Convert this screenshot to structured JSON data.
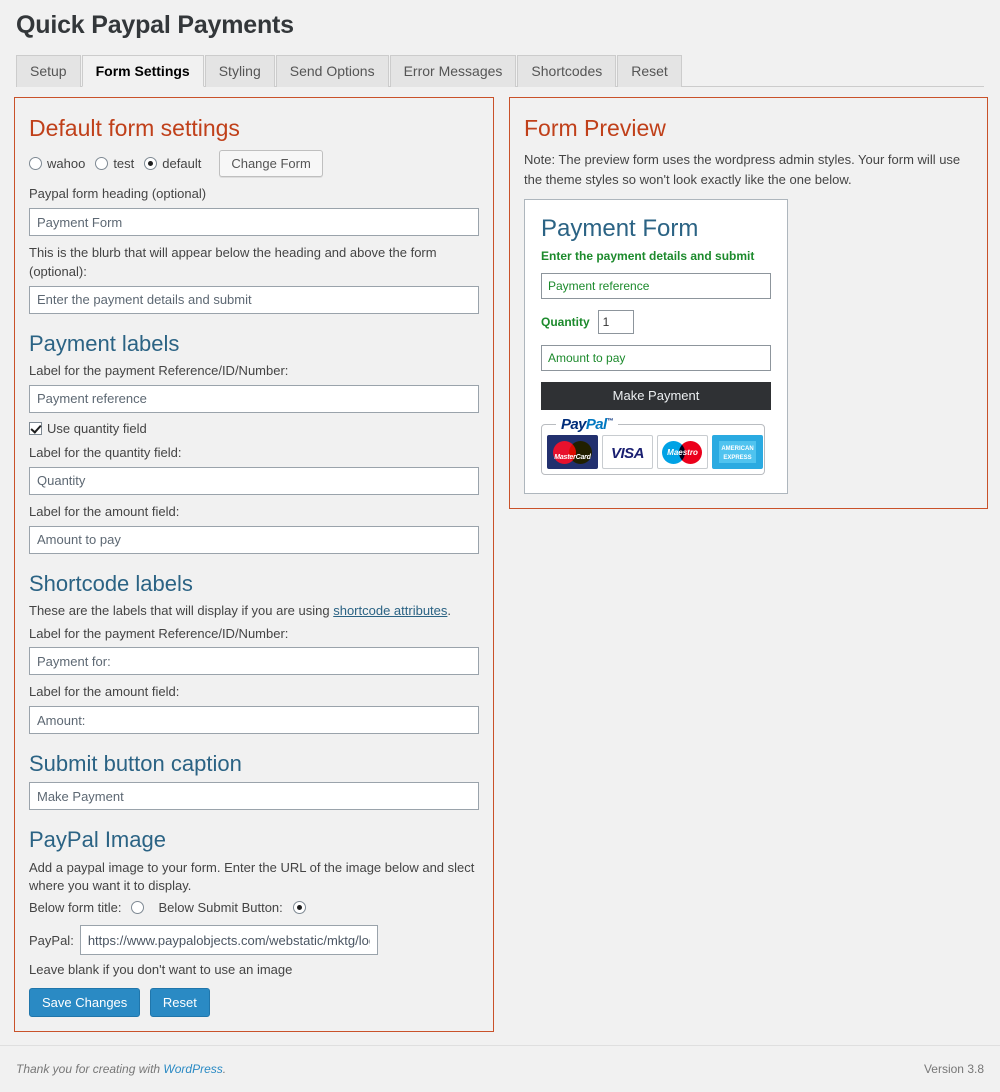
{
  "page_title": "Quick Paypal Payments",
  "tabs": [
    {
      "label": "Setup",
      "active": false
    },
    {
      "label": "Form Settings",
      "active": true
    },
    {
      "label": "Styling",
      "active": false
    },
    {
      "label": "Send Options",
      "active": false
    },
    {
      "label": "Error Messages",
      "active": false
    },
    {
      "label": "Shortcodes",
      "active": false
    },
    {
      "label": "Reset",
      "active": false
    }
  ],
  "left_panel": {
    "heading": "Default form settings",
    "form_radios": [
      {
        "label": "wahoo",
        "checked": false
      },
      {
        "label": "test",
        "checked": false
      },
      {
        "label": "default",
        "checked": true
      }
    ],
    "change_form_button": "Change Form",
    "heading_label": "Paypal form heading (optional)",
    "heading_value": "Payment Form",
    "blurb_label": "This is the blurb that will appear below the heading and above the form (optional):",
    "blurb_value": "Enter the payment details and submit",
    "payment_labels": {
      "heading": "Payment labels",
      "reference_label": "Label for the payment Reference/ID/Number:",
      "reference_value": "Payment reference",
      "use_quantity_label": "Use quantity field",
      "use_quantity_checked": true,
      "quantity_label": "Label for the quantity field:",
      "quantity_value": "Quantity",
      "amount_label": "Label for the amount field:",
      "amount_value": "Amount to pay"
    },
    "shortcode_labels": {
      "heading": "Shortcode labels",
      "desc_before": "These are the labels that will display if you are using ",
      "desc_link": "shortcode attributes",
      "desc_after": ".",
      "reference_label": "Label for the payment Reference/ID/Number:",
      "reference_value": "Payment for:",
      "amount_label": "Label for the amount field:",
      "amount_value": "Amount:"
    },
    "submit_caption": {
      "heading": "Submit button caption",
      "value": "Make Payment"
    },
    "paypal_image": {
      "heading": "PayPal Image",
      "desc": "Add a paypal image to your form. Enter the URL of the image below and slect where you want it to display.",
      "below_title_label": "Below form title:",
      "below_title_checked": false,
      "below_submit_label": "Below Submit Button:",
      "below_submit_checked": true,
      "url_label": "PayPal:",
      "url_value": "https://www.paypalobjects.com/webstatic/mktg/log",
      "blank_note": "Leave blank if you don't want to use an image"
    },
    "save_button": "Save Changes",
    "reset_button": "Reset"
  },
  "right_panel": {
    "heading": "Form Preview",
    "note": "Note: The preview form uses the wordpress admin styles. Your form will use the theme styles so won't look exactly like the one below.",
    "preview": {
      "title": "Payment Form",
      "blurb": "Enter the payment details and submit",
      "reference_placeholder": "Payment reference",
      "quantity_label": "Quantity",
      "quantity_value": "1",
      "amount_placeholder": "Amount to pay",
      "submit_label": "Make Payment",
      "paypal_badge": {
        "wordmark_part1": "Pay",
        "wordmark_part2": "Pal",
        "trademark": "™",
        "cards": [
          "MasterCard",
          "VISA",
          "Maestro",
          "AMERICAN EXPRESS"
        ]
      }
    }
  },
  "footer": {
    "thanks_before": "Thank you for creating with ",
    "thanks_link": "WordPress",
    "thanks_after": ".",
    "version": "Version 3.8"
  },
  "colors": {
    "panel_border": "#c9522a",
    "heading_red": "#c0401a",
    "heading_blue": "#2b6384",
    "preview_green": "#1c8a2c",
    "button_blue": "#2a8ac4",
    "submit_dark": "#2f3134"
  }
}
